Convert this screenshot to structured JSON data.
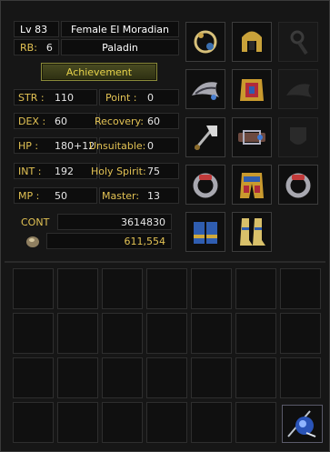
{
  "character": {
    "level": "Lv 83",
    "name": "Female El Moradian",
    "rb_label": "RB:",
    "rb_value": "6",
    "class": "Paladin",
    "achievement_label": "Achievement"
  },
  "stats": {
    "str_label": "STR :",
    "str_value": "110",
    "dex_label": "DEX :",
    "dex_value": "60",
    "hp_label": "HP :",
    "hp_value": "180+12",
    "int_label": "INT :",
    "int_value": "192",
    "mp_label": "MP :",
    "mp_value": "50",
    "point_label": "Point :",
    "point_value": "0",
    "recovery_label": "Recovery:",
    "recovery_value": "60",
    "unsuitable_label": "Unsuitable:",
    "unsuitable_value": "0",
    "holy_label": "Holy Spirit:",
    "holy_value": "75",
    "master_label": "Master:",
    "master_value": "13"
  },
  "cont": {
    "label": "CONT",
    "value": "3614830",
    "coins": "611,554"
  },
  "equipment": [
    "necklace-icon",
    "helmet-icon",
    "earring-icon",
    "pauldron-icon",
    "weapon-icon",
    "gloves-icon",
    "belt-icon",
    "ring-icon",
    "armor-icon",
    "ring-icon",
    "pants-icon",
    "boots-icon"
  ],
  "inventory": {
    "quick_item": "blue-pendant-icon"
  },
  "colors": {
    "gold": "#e2c254",
    "achievement_text": "#e6d24a"
  }
}
